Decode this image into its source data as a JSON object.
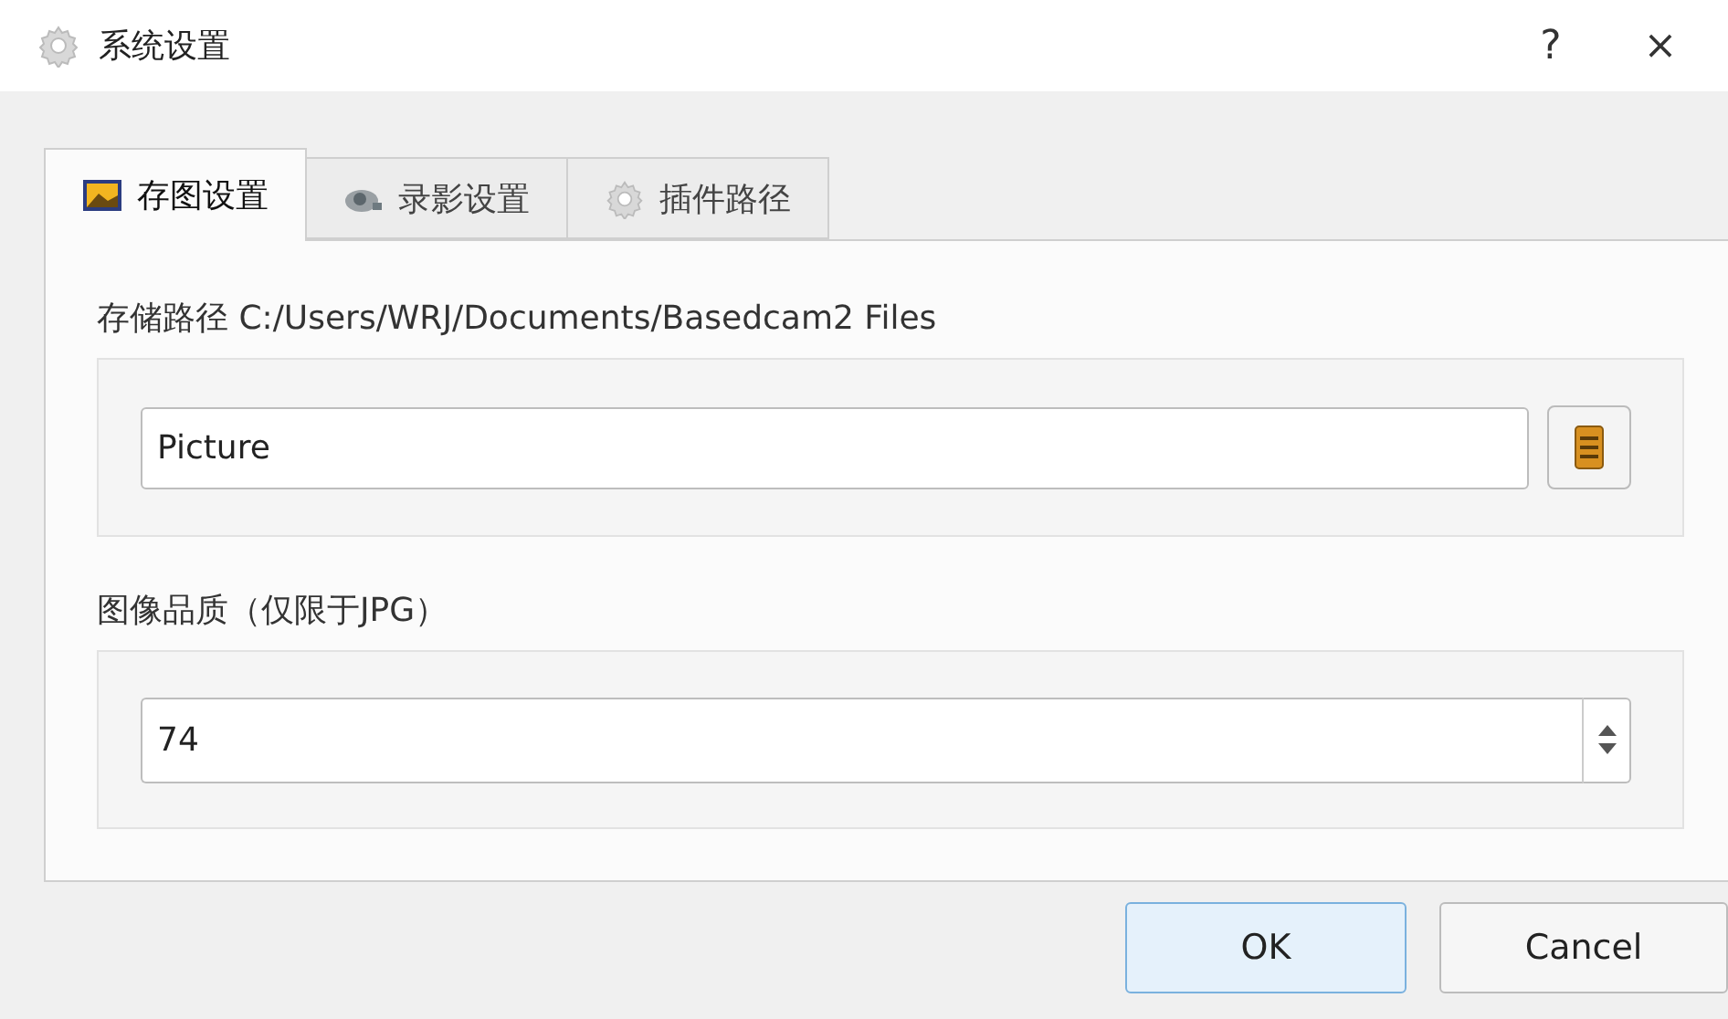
{
  "window": {
    "title": "系统设置",
    "help": "?",
    "close": "×"
  },
  "tabs": [
    {
      "label": "存图设置",
      "kind": "picture",
      "selected": true
    },
    {
      "label": "录影设置",
      "kind": "camera",
      "selected": false
    },
    {
      "label": "插件路径",
      "kind": "gear",
      "selected": false
    }
  ],
  "storage": {
    "label": "存储路径 C:/Users/WRJ/Documents/Basedcam2 Files",
    "value": "Picture"
  },
  "quality": {
    "label": "图像品质（仅限于JPG）",
    "value": "74"
  },
  "buttons": [
    {
      "label": "OK",
      "default": true
    },
    {
      "label": "Cancel",
      "default": false
    }
  ]
}
